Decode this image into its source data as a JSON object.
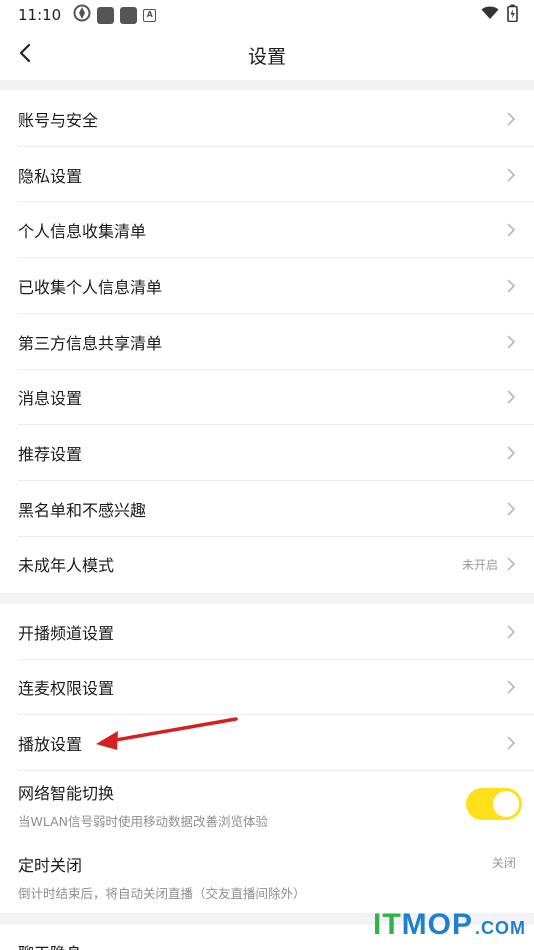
{
  "status_bar": {
    "time": "11:10",
    "icons": [
      "sync-icon",
      "app-icon",
      "app-icon",
      "a-icon",
      "wifi-icon",
      "battery-icon"
    ]
  },
  "header": {
    "title": "设置",
    "back_icon": "chevron-left-icon"
  },
  "group1": [
    {
      "label": "账号与安全",
      "value": ""
    },
    {
      "label": "隐私设置",
      "value": ""
    },
    {
      "label": "个人信息收集清单",
      "value": ""
    },
    {
      "label": "已收集个人信息清单",
      "value": ""
    },
    {
      "label": "第三方信息共享清单",
      "value": ""
    },
    {
      "label": "消息设置",
      "value": ""
    },
    {
      "label": "推荐设置",
      "value": ""
    },
    {
      "label": "黑名单和不感兴趣",
      "value": ""
    },
    {
      "label": "未成年人模式",
      "value": "未开启"
    }
  ],
  "group2": [
    {
      "label": "开播频道设置"
    },
    {
      "label": "连麦权限设置"
    },
    {
      "label": "播放设置"
    }
  ],
  "network_switch": {
    "label": "网络智能切换",
    "description": "当WLAN信号弱时使用移动数据改善浏览体验",
    "enabled": true
  },
  "timer_off": {
    "label": "定时关闭",
    "description": "倒计时结束后，将自动关闭直播（交友直播间除外）",
    "value": "关闭"
  },
  "partial_item": {
    "label": "聊天隐身"
  },
  "colors": {
    "accent": "#ffe01b",
    "arrow": "#d42020",
    "section_gap": "#f3f3f6"
  },
  "watermark": {
    "part1": "IT",
    "part2": "MOP",
    "part3": ".COM"
  }
}
